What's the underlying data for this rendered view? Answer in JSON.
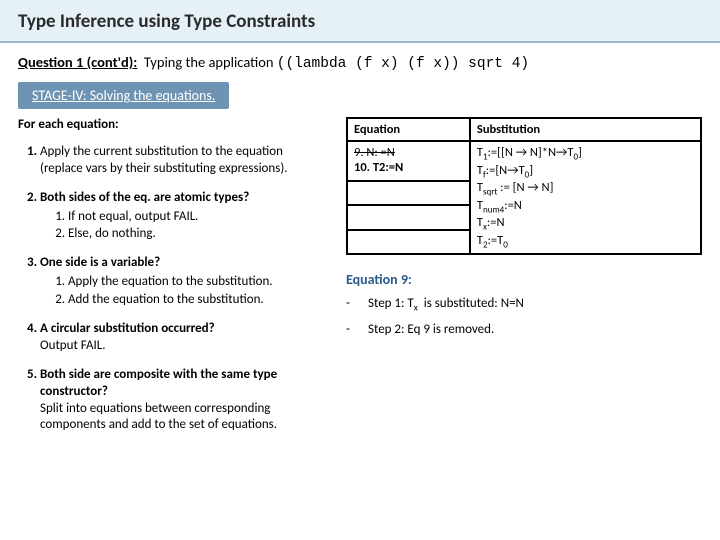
{
  "title": "Type Inference using Type Constraints",
  "question": {
    "label": "Question 1 (cont'd):",
    "lead": "Typing the application",
    "code": "((lambda (f x)  (f x)) sqrt 4)"
  },
  "stage": "STAGE-IV: Solving the equations.",
  "steps": {
    "lead": "For each equation:",
    "s1": "Apply the current substitution to the equation (replace vars by their substituting expressions).",
    "s2": {
      "head": "Both sides of the eq. are atomic types?",
      "a": "If not equal, output FAIL.",
      "b": "Else, do nothing."
    },
    "s3": {
      "head": "One side is a variable?",
      "a": "Apply the equation to the substitution.",
      "b": "Add the equation to the substitution."
    },
    "s4": {
      "head": "A circular substitution occurred?",
      "body": "Output FAIL."
    },
    "s5": {
      "head": "Both side are composite with the same type constructor?",
      "body": "Split into equations between corresponding components and add to the set of equations."
    }
  },
  "table": {
    "h1": "Equation",
    "h2": "Substitution",
    "eq_cell": {
      "line9": "9. N: =N",
      "line10": "10. T2:=N"
    },
    "sub_cell": {
      "l1": "T1:=[[N → N]*N→T0]",
      "l2": "Tf:=[N→T0]",
      "l3": "Tsqrt := [N → N]",
      "l4": "Tnum4:=N",
      "l5": "Tx:=N",
      "l6": "T2:=T0"
    }
  },
  "eq9": {
    "title": "Equation 9:",
    "step1": {
      "label": "Step 1: Tx",
      "rest": " is substituted: N=N"
    },
    "step2": "Step 2: Eq 9 is removed."
  }
}
